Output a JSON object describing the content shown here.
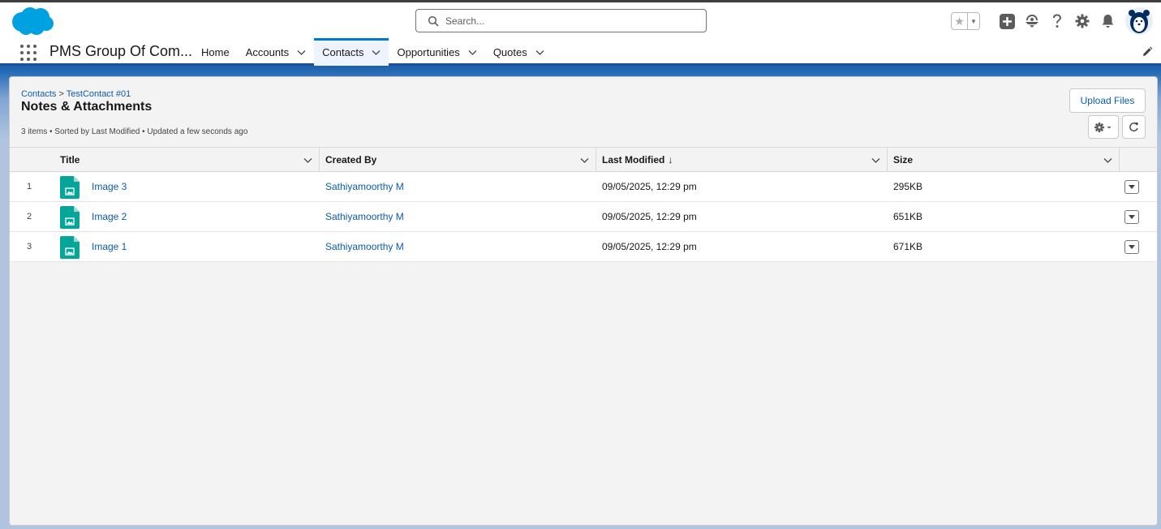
{
  "header": {
    "search_placeholder": "Search...",
    "icons": [
      "salesforce-logo",
      "star-icon",
      "chevron-down-icon",
      "add-icon",
      "trailhead-icon",
      "help-icon",
      "setup-gear-icon",
      "bell-icon",
      "avatar"
    ]
  },
  "nav": {
    "app_name": "PMS Group Of Com...",
    "items": [
      {
        "label": "Home",
        "dropdown": false
      },
      {
        "label": "Accounts",
        "dropdown": true
      },
      {
        "label": "Contacts",
        "dropdown": true,
        "active": true
      },
      {
        "label": "Opportunities",
        "dropdown": true
      },
      {
        "label": "Quotes",
        "dropdown": true
      }
    ]
  },
  "page": {
    "breadcrumb_parent": "Contacts",
    "breadcrumb_sep": ">",
    "breadcrumb_record": "TestContact #01",
    "title": "Notes & Attachments",
    "list_info": "3 items • Sorted by Last Modified • Updated a few seconds ago",
    "upload_label": "Upload Files"
  },
  "table": {
    "columns": {
      "title": "Title",
      "created_by": "Created By",
      "last_modified": "Last Modified",
      "size": "Size"
    },
    "sort_indicator": "↓",
    "rows": [
      {
        "num": "1",
        "title": "Image 3",
        "created_by": "Sathiyamoorthy M",
        "last_modified": "09/05/2025, 12:29 pm",
        "size": "295KB"
      },
      {
        "num": "2",
        "title": "Image 2",
        "created_by": "Sathiyamoorthy M",
        "last_modified": "09/05/2025, 12:29 pm",
        "size": "651KB"
      },
      {
        "num": "3",
        "title": "Image 1",
        "created_by": "Sathiyamoorthy M",
        "last_modified": "09/05/2025, 12:29 pm",
        "size": "671KB"
      }
    ]
  },
  "colors": {
    "brand_blue": "#0176d3",
    "link_blue": "#0b5cab",
    "file_icon_green": "#06a59a",
    "salesforce_cloud": "#00a1e0"
  }
}
